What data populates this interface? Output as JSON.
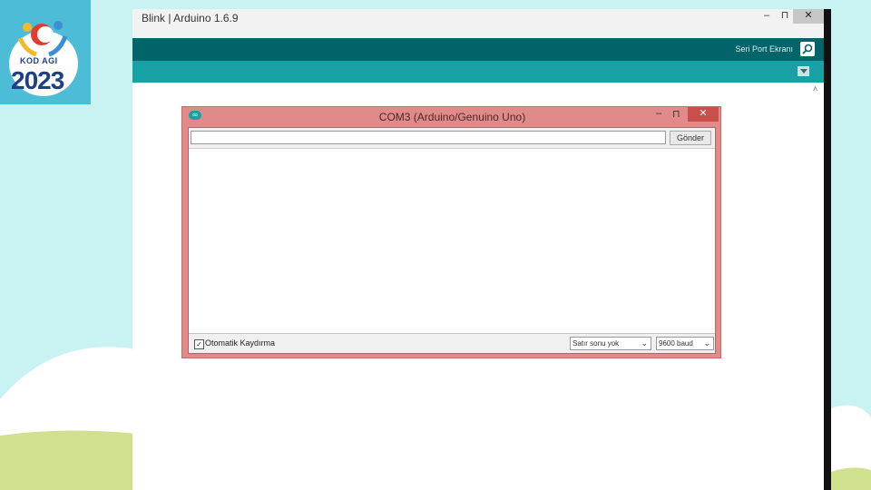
{
  "logo": {
    "kod": "KOD AGI",
    "year": "2023"
  },
  "ide": {
    "title": "Blink | Arduino 1.6.9",
    "window_controls": {
      "minimize": "‒",
      "maximize": "⊓",
      "close": "✕"
    },
    "serial_monitor_label": "Seri Port Ekranı",
    "serial_monitor_icon": "magnifier-icon",
    "scroll_up": "˄"
  },
  "serial_monitor": {
    "title": "COM3 (Arduino/Genuino Uno)",
    "window_controls": {
      "minimize": "‒",
      "maximize": "⊓",
      "close": "✕"
    },
    "input_value": "",
    "send_label": "Gönder",
    "autoscroll_label": "Otomatik Kaydırma",
    "autoscroll_checked": "✓",
    "line_ending_selected": "Satır sonu yok",
    "baud_selected": "9600 baud",
    "dropdown_arrow": "⌄"
  },
  "colors": {
    "ide_toolbar": "#006468",
    "ide_tabbar": "#17a1a5",
    "serial_monitor_frame": "#e08a8a",
    "background": "#c9f3f3",
    "logo_bg": "#4dbcd6"
  }
}
